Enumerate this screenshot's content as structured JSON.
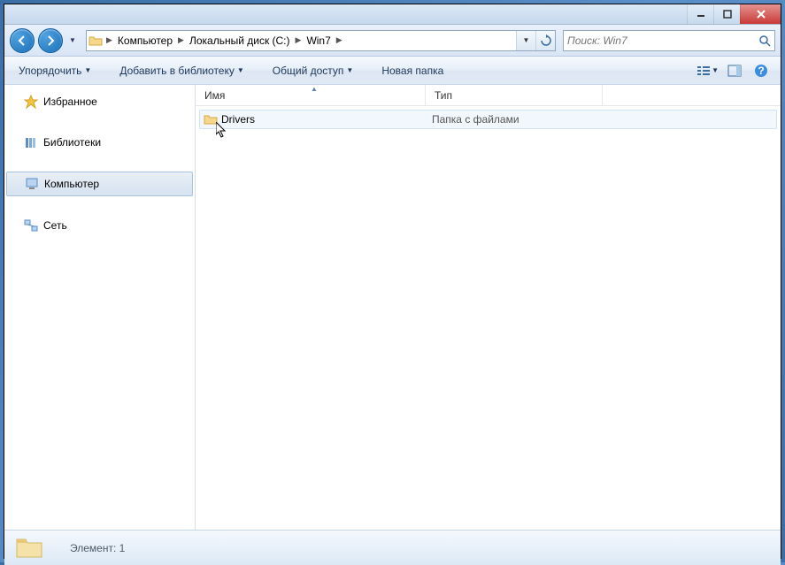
{
  "breadcrumb": {
    "segments": [
      "Компьютер",
      "Локальный диск (C:)",
      "Win7"
    ]
  },
  "search": {
    "placeholder": "Поиск: Win7"
  },
  "toolbar": {
    "organize": "Упорядочить",
    "add_library": "Добавить в библиотеку",
    "share": "Общий доступ",
    "new_folder": "Новая папка"
  },
  "sidebar": {
    "favorites": "Избранное",
    "libraries": "Библиотеки",
    "computer": "Компьютер",
    "network": "Сеть"
  },
  "columns": {
    "name": "Имя",
    "type": "Тип"
  },
  "files": [
    {
      "name": "Drivers",
      "type": "Папка с файлами"
    }
  ],
  "status": {
    "count_label": "Элемент: 1"
  }
}
